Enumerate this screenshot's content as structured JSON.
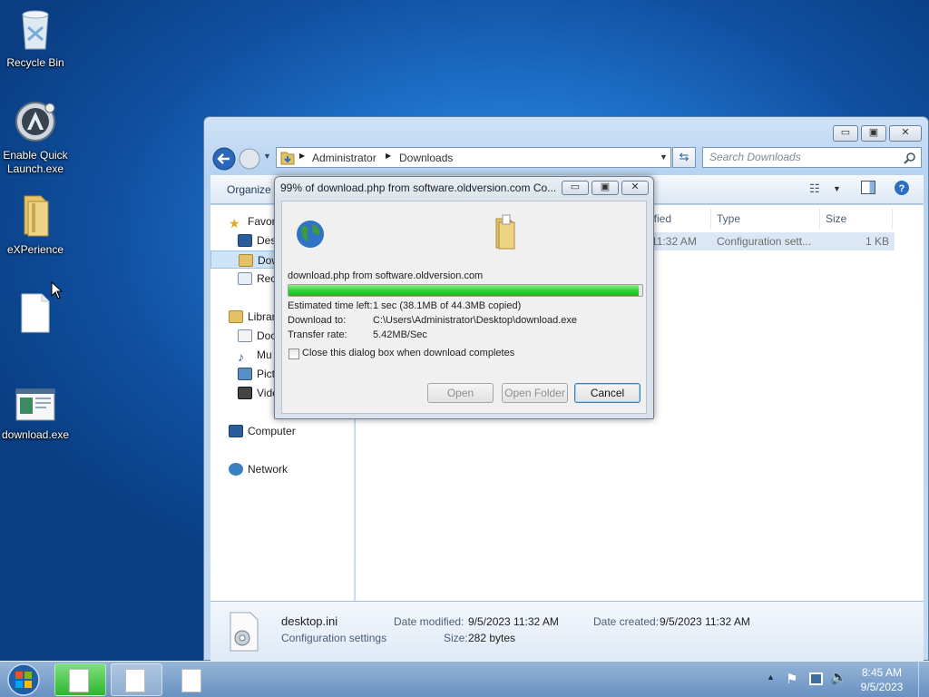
{
  "desktop": {
    "icons": [
      {
        "label": "Recycle Bin"
      },
      {
        "label": "Enable Quick\nLaunch.exe"
      },
      {
        "label": "eXPerience"
      },
      {
        "label": ""
      },
      {
        "label": "download.exe"
      }
    ]
  },
  "explorer": {
    "breadcrumb": [
      "Administrator",
      "Downloads"
    ],
    "search_placeholder": "Search Downloads",
    "toolbar": {
      "organize": "Organize"
    },
    "nav": {
      "favorites": "Favor",
      "desktop": "Des",
      "downloads": "Dow",
      "recent": "Rec",
      "libraries": "Librar",
      "documents": "Doc",
      "music": "Mu",
      "pictures": "Pict",
      "videos": "Vide",
      "computer": "Computer",
      "network": "Network"
    },
    "columns": {
      "modified": "ified",
      "type": "Type",
      "size": "Size"
    },
    "rows": [
      {
        "modified": "11:32 AM",
        "type": "Configuration sett...",
        "size": "1 KB"
      }
    ],
    "details": {
      "filename": "desktop.ini",
      "filetype": "Configuration settings",
      "modified_label": "Date modified:",
      "modified_value": "9/5/2023 11:32 AM",
      "created_label": "Date created:",
      "created_value": "9/5/2023 11:32 AM",
      "size_label": "Size:",
      "size_value": "282 bytes"
    }
  },
  "dialog": {
    "title": "99% of download.php from software.oldversion.com Co...",
    "source": "download.php from software.oldversion.com",
    "progress_percent": 99,
    "eta_label": "Estimated time left:",
    "eta_value": "1 sec (38.1MB of 44.3MB copied)",
    "download_to_label": "Download to:",
    "download_to_value": "C:\\Users\\Administrator\\Desktop\\download.exe",
    "rate_label": "Transfer rate:",
    "rate_value": "5.42MB/Sec",
    "checkbox_label": "Close this dialog box when download completes",
    "buttons": {
      "open": "Open",
      "open_folder": "Open Folder",
      "cancel": "Cancel"
    }
  },
  "taskbar": {
    "time": "8:45 AM",
    "date": "9/5/2023"
  },
  "colors": {
    "progress": "#3bd33b",
    "accent": "#3a7fd5"
  }
}
